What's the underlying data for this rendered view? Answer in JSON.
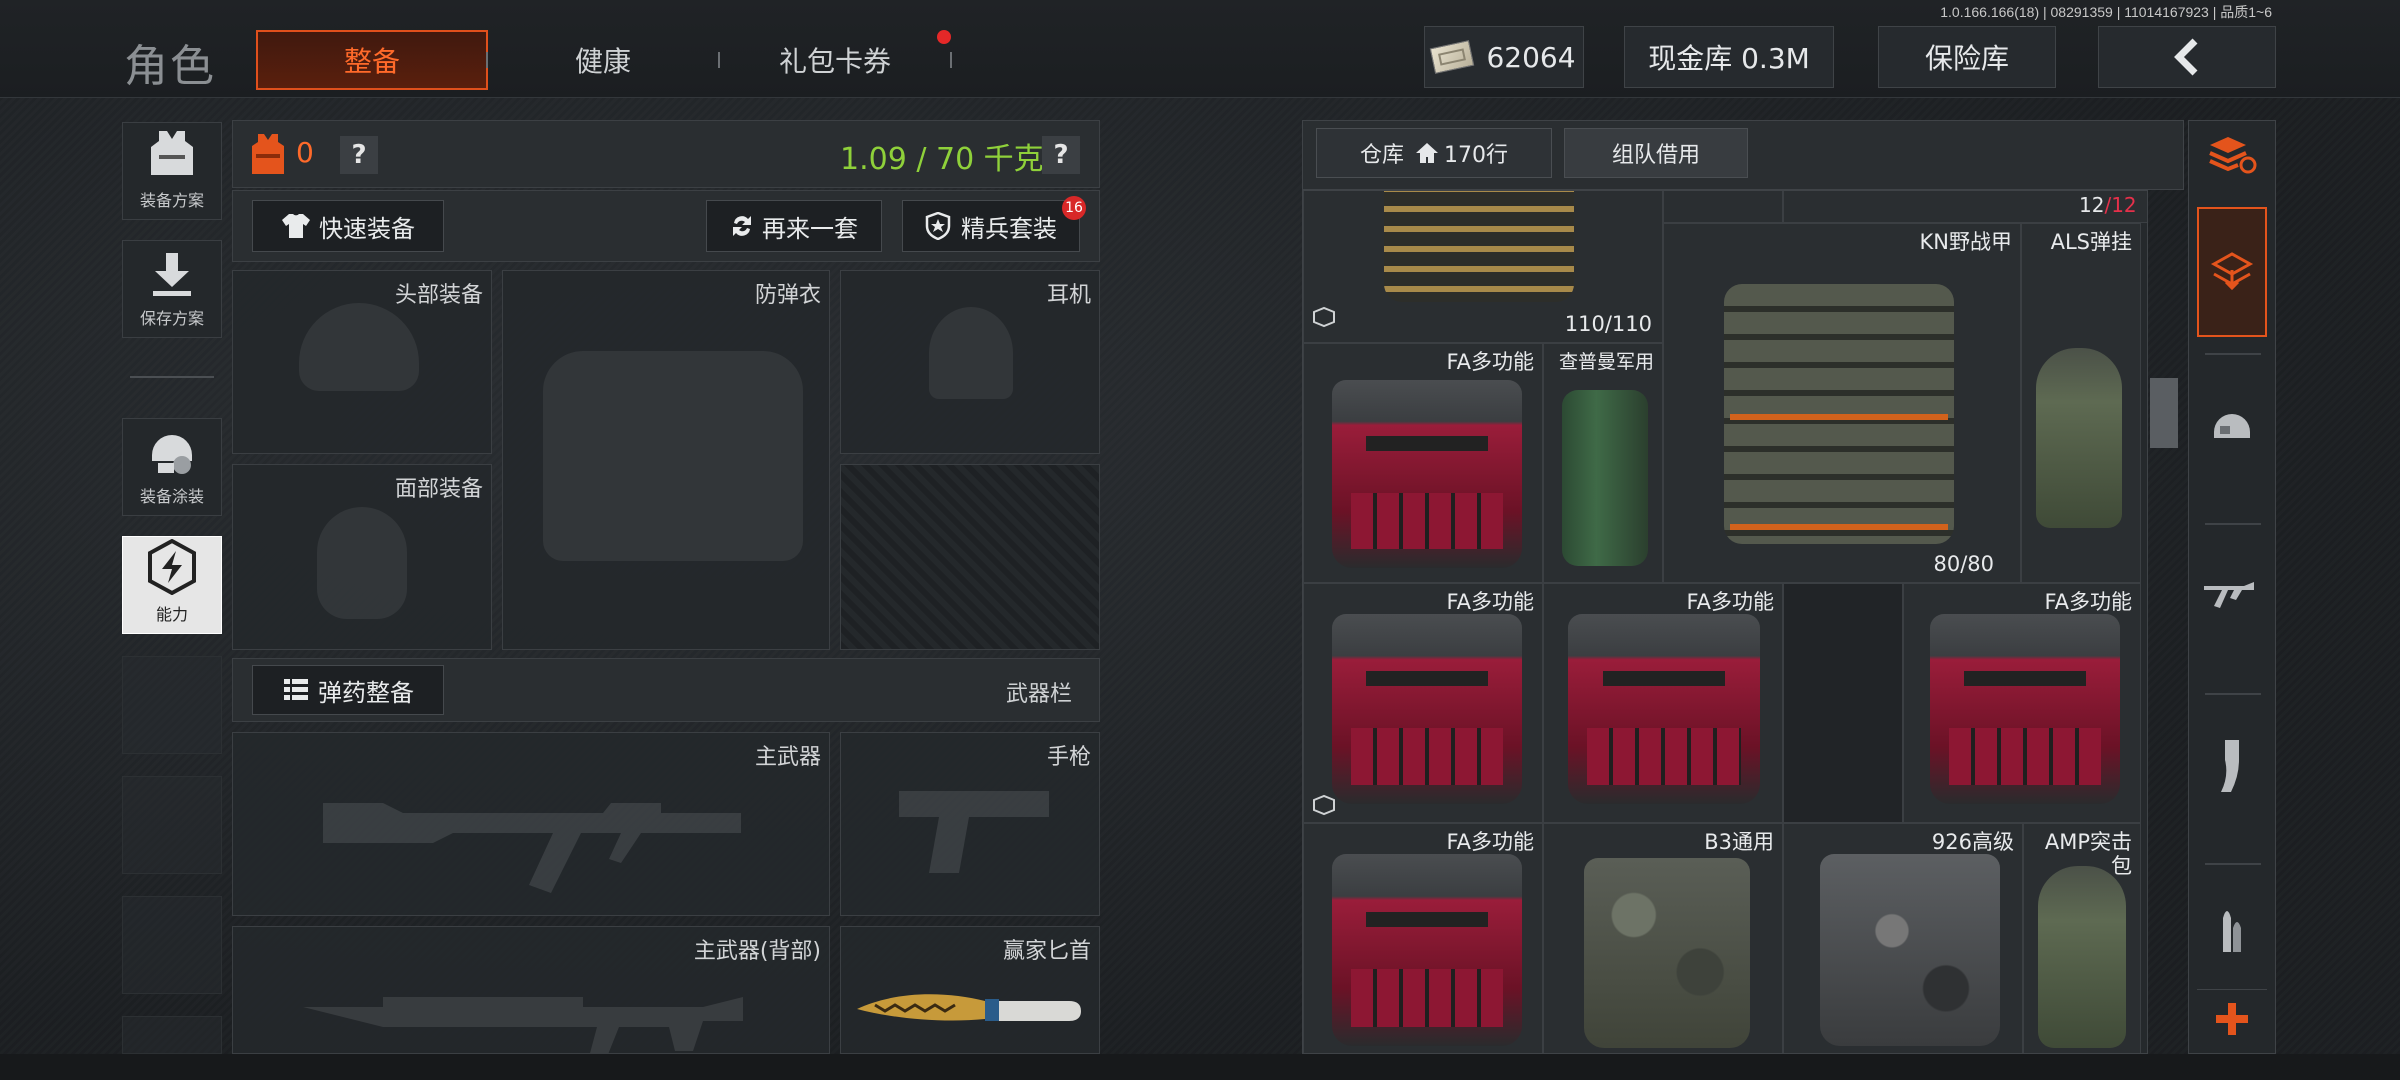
{
  "version_text": "1.0.166.166(18) | 08291359 | 11014167923 | 品质1~6",
  "header": {
    "title": "角色",
    "tabs": [
      {
        "label": "整备",
        "active": true
      },
      {
        "label": "健康",
        "active": false
      },
      {
        "label": "礼包卡券",
        "active": false,
        "has_notification": true
      }
    ],
    "currency_amount": "62064",
    "cash_storage": "现金库 0.3M",
    "insurance": "保险库",
    "back_icon": "chevron-left-icon"
  },
  "sidebar": {
    "items": [
      {
        "label": "装备方案",
        "icon": "vest-icon"
      },
      {
        "label": "保存方案",
        "icon": "download-icon"
      },
      {
        "label": "装备涂装",
        "icon": "helmet-paint-icon"
      },
      {
        "label": "能力",
        "icon": "lightning-hex-icon",
        "selected": true
      }
    ]
  },
  "gear": {
    "armor_count": "0",
    "help": "?",
    "weight": "1.09 / 70 千克",
    "quick_equip": "快速装备",
    "again": "再来一套",
    "elite_set": "精兵套装",
    "elite_badge": "16",
    "slots": {
      "head": "头部装备",
      "armor": "防弹衣",
      "headset": "耳机",
      "face": "面部装备"
    },
    "ammo_button": "弹药整备",
    "weapon_bar": "武器栏",
    "weapons": {
      "primary": "主武器",
      "pistol": "手枪",
      "primary_back": "主武器(背部)",
      "knife": "赢家匕首"
    }
  },
  "warehouse": {
    "tabs": [
      {
        "label": "仓库",
        "icon": "home-icon",
        "rows": "170行"
      },
      {
        "label": "组队借用"
      }
    ],
    "page_current": "12",
    "page_total": "/12",
    "items": [
      {
        "label": "",
        "count": "110/110"
      },
      {
        "label": "KN野战甲",
        "count": "80/80"
      },
      {
        "label": "ALS弹挂"
      },
      {
        "label": "FA多功能"
      },
      {
        "label": "查普曼军用"
      },
      {
        "label": "FA多功能"
      },
      {
        "label": "FA多功能"
      },
      {
        "label": "FA多功能"
      },
      {
        "label": "FA多功能"
      },
      {
        "label": "B3通用"
      },
      {
        "label": "926高级"
      },
      {
        "label": "AMP突击包"
      }
    ]
  },
  "rail_icons": [
    "layers-refresh-icon",
    "stack-download-icon",
    "helmet-icon",
    "rifle-icon",
    "magazine-icon",
    "bullets-icon",
    "plus-icon"
  ],
  "colors": {
    "accent": "#ff6a2a",
    "weight_green": "#8fd13a",
    "page_red": "#e5304a"
  }
}
